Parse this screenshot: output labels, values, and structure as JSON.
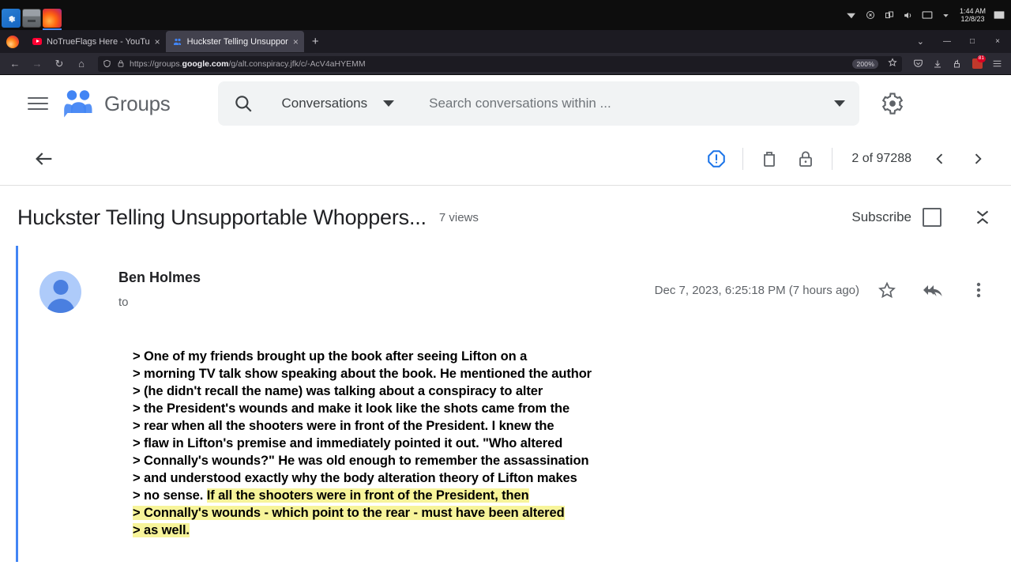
{
  "os": {
    "taskbar": {
      "apps": [
        {
          "name": "settings-app",
          "label": "Settings"
        },
        {
          "name": "files-app",
          "label": "Files"
        },
        {
          "name": "firefox-app",
          "label": "Firefox"
        }
      ],
      "tray": {
        "time": "1:44 AM",
        "date": "12/8/23"
      }
    }
  },
  "browser": {
    "tabs": [
      {
        "title": "NoTrueFlags Here - YouTu",
        "favicon": "youtube-icon",
        "active": false
      },
      {
        "title": "Huckster Telling Unsuppor",
        "favicon": "google-groups-icon",
        "active": true
      }
    ],
    "new_tab_label": "+",
    "close_label": "×",
    "window_controls": {
      "list_all_tabs": "⌄",
      "minimize": "—",
      "maximize": "□",
      "close": "×"
    },
    "nav": {
      "back": "←",
      "forward": "→",
      "reload": "↻",
      "home": "⌂"
    },
    "url": {
      "scheme": "https://groups.",
      "domain": "google.com",
      "path": "/g/alt.conspiracy.jfk/c/-AcV4aHYEMM",
      "full": "https://groups.google.com/g/alt.conspiracy.jfk/c/-AcV4aHYEMM",
      "zoom_level": "200%"
    },
    "extension_badge_count": "81"
  },
  "groups": {
    "product_name": "Groups",
    "search": {
      "scope_label": "Conversations",
      "placeholder": "Search conversations within  ..."
    },
    "toolbar": {
      "report_label": "Report",
      "delete_label": "Delete",
      "lock_label": "Lock",
      "position_text": "2 of 97288",
      "prev_label": "‹",
      "next_label": "›"
    },
    "conversation": {
      "title": "Huckster Telling Unsupportable Whoppers...",
      "views": "7 views",
      "subscribe_label": "Subscribe"
    },
    "message": {
      "author": "Ben Holmes",
      "to_label": "to",
      "date": "Dec 7, 2023, 6:25:18 PM (7 hours ago)",
      "body_lines": [
        {
          "text": "> One of my friends brought up the book after seeing Lifton on a",
          "highlight": "none"
        },
        {
          "text": "> morning TV talk show speaking about the book. He mentioned the author",
          "highlight": "none"
        },
        {
          "text": "> (he didn't recall the name) was talking about a conspiracy to alter",
          "highlight": "none"
        },
        {
          "text": "> the President's wounds and make it look like the shots came from the",
          "highlight": "none"
        },
        {
          "text": "> rear when all the shooters were in front of the President. I knew the",
          "highlight": "none"
        },
        {
          "text": "> flaw in Lifton's premise and immediately pointed it out. \"Who altered",
          "highlight": "none"
        },
        {
          "text": "> Connally's wounds?\" He was old enough to remember the assassination",
          "highlight": "none"
        },
        {
          "text": "> and understood exactly why the body alteration theory of Lifton makes",
          "highlight": "none"
        },
        {
          "text": "> no sense. ",
          "highlight": "partial",
          "highlighted_text": "If all the shooters were in front of the President, then"
        },
        {
          "text": "> Connally's wounds - which point to the rear - must have been altered",
          "highlight": "full"
        },
        {
          "text": "> as well.",
          "highlight": "full"
        }
      ]
    }
  },
  "colors": {
    "accent_blue": "#4285f4",
    "highlight_yellow": "#f7f49a",
    "groups_logo_blue": "#4285f4",
    "text_primary": "#202124",
    "text_secondary": "#5f6368"
  }
}
